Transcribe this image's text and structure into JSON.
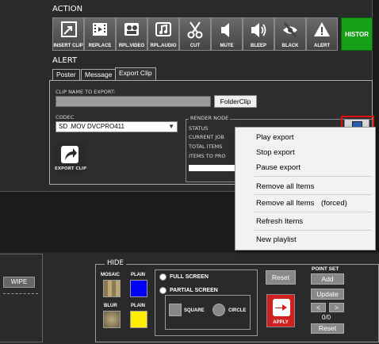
{
  "action": {
    "label": "ACTION",
    "buttons": [
      {
        "label": "INSERT CLIP",
        "icon": "insert-clip-icon"
      },
      {
        "label": "REPLACE",
        "icon": "film-replace-icon"
      },
      {
        "label": "RPL.VIDEO",
        "icon": "replace-video-icon"
      },
      {
        "label": "RPL.AUDIO",
        "icon": "replace-audio-icon"
      },
      {
        "label": "CUT",
        "icon": "scissors-icon"
      },
      {
        "label": "MUTE",
        "icon": "mute-icon"
      },
      {
        "label": "BLEEP",
        "icon": "speaker-icon"
      },
      {
        "label": "BLACK",
        "icon": "eye-off-icon"
      },
      {
        "label": "ALERT",
        "icon": "warning-icon"
      }
    ],
    "histor_label": "HISTOR",
    "histor_color": "#17a017"
  },
  "alert": {
    "label": "ALERT",
    "tabs": [
      {
        "label": "Poster",
        "active": false
      },
      {
        "label": "Message",
        "active": false
      },
      {
        "label": "Export Clip",
        "active": true
      }
    ],
    "clip_name_label": "CLIP NAME TO EXPORT:",
    "clip_name_value": "",
    "folder_clip_label": "FolderClip",
    "codec_label": "CODEC",
    "codec_value": "SD .MOV DVCPRO411",
    "export_clip_label": "EXPORT CLIP",
    "render_node_label": "RENDER NODE",
    "status_label": "STATUS",
    "current_job_label": "CURRENT JOB",
    "total_items_label": "TOTAL ITEMS",
    "items_to_process_label": "ITEMS TO PRO"
  },
  "context_menu": {
    "items": [
      "Play export",
      "Stop export",
      "Pause export",
      "Remove all Items",
      "Remove all Items",
      "Refresh Items",
      "New playlist"
    ],
    "forced_suffix": "(forced)"
  },
  "bottom": {
    "wipe_label": "WIPE",
    "hide_label": "HIDE",
    "mosaic_label": "MOSAIC",
    "plain_label_1": "PLAIN",
    "blur_label": "BLUR",
    "plain_label_2": "PLAIN",
    "plain_color_1": "#0000ff",
    "plain_color_2": "#ffee00",
    "full_screen_label": "FULL SCREEN",
    "partial_screen_label": "PARTIAL SCREEN",
    "square_label": "SQUARE",
    "circle_label": "CIRCLE",
    "reset_label": "Reset",
    "apply_label": "APPLY",
    "point_set_label": "POINT SET",
    "add_label": "Add",
    "update_label": "Update",
    "prev_label": "<",
    "next_label": ">",
    "counter": "0/0",
    "reset2_label": "Reset"
  },
  "colors": {
    "highlight_border": "#e01010",
    "apply_red": "#d02020"
  }
}
